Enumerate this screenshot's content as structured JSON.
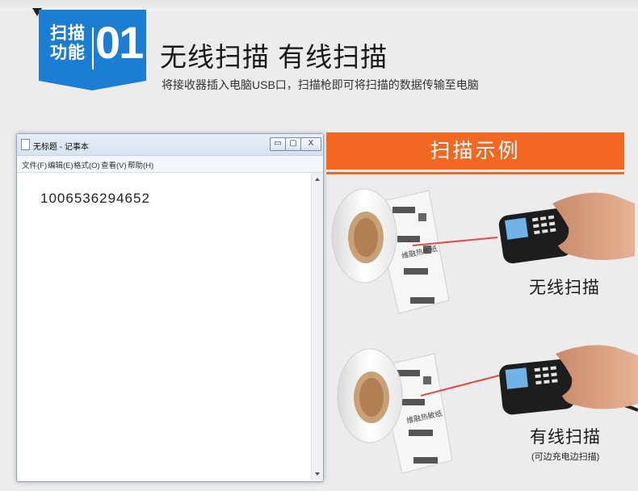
{
  "section_badge": {
    "label_line1": "扫描",
    "label_line2": "功能",
    "number": "01"
  },
  "heading": {
    "title": "无线扫描 有线扫描",
    "subtitle": "将接收器插入电脑USB口，扫描枪即可将扫描的数据传输至电脑"
  },
  "notepad": {
    "window_title": "无标题 - 记事本",
    "minimize_label": "▭",
    "maximize_label": "▢",
    "close_label": "X",
    "menu": [
      "文件(F)",
      "编辑(E)",
      "格式(O)",
      "查看(V)",
      "帮助(H)"
    ],
    "content": "1006536294652"
  },
  "demo": {
    "header": "扫描示例",
    "wireless_label": "无线扫描",
    "wired_label": "有线扫描",
    "wired_note": "(可边充电边扫描)",
    "label_roll_text": "维融热敏纸"
  },
  "colors": {
    "badge_blue": "#1b7ed2",
    "accent_orange": "#f26722",
    "laser_red": "#e0201a"
  }
}
